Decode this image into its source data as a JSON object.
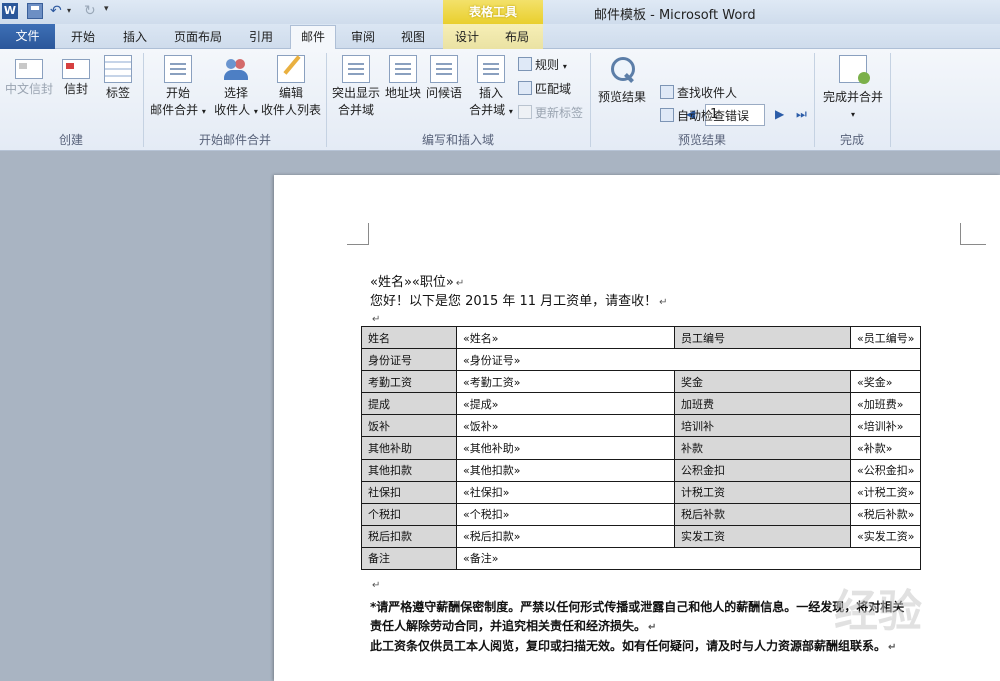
{
  "window": {
    "title": "邮件模板 - Microsoft Word",
    "context_tab_header": "表格工具",
    "app_logo_letter": "W"
  },
  "tabs": [
    {
      "label": "文件"
    },
    {
      "label": "开始"
    },
    {
      "label": "插入"
    },
    {
      "label": "页面布局"
    },
    {
      "label": "引用"
    },
    {
      "label": "邮件"
    },
    {
      "label": "审阅"
    },
    {
      "label": "视图"
    },
    {
      "label": "设计"
    },
    {
      "label": "布局"
    }
  ],
  "ribbon": {
    "create": {
      "label": "创建",
      "chinese_envelope": "中文信封",
      "envelope": "信封",
      "labels": "标签"
    },
    "start_merge": {
      "label": "开始邮件合并",
      "start_line1": "开始",
      "start_line2": "邮件合并",
      "select_line1": "选择",
      "select_line2": "收件人",
      "edit_line1": "编辑",
      "edit_line2": "收件人列表"
    },
    "write_insert": {
      "label": "编写和插入域",
      "highlight_line1": "突出显示",
      "highlight_line2": "合并域",
      "address_block": "地址块",
      "greeting_line": "问候语",
      "insert_line1": "插入",
      "insert_line2": "合并域",
      "rules": "规则",
      "match_fields": "匹配域",
      "update_labels": "更新标签"
    },
    "preview": {
      "label": "预览结果",
      "preview_results": "预览结果",
      "record_number": "1",
      "find_recipient": "查找收件人",
      "auto_check": "自动检查错误"
    },
    "finish": {
      "label": "完成",
      "finish_merge": "完成并合并"
    }
  },
  "document": {
    "line1": "«姓名»«职位»",
    "line2": "您好！以下是您 2015 年 11 月工资单，请查收！",
    "table": [
      [
        "姓名",
        "«姓名»",
        "员工编号",
        "«员工编号»"
      ],
      [
        "身份证号",
        "«身份证号»"
      ],
      [
        "考勤工资",
        "«考勤工资»",
        "奖金",
        "«奖金»"
      ],
      [
        "提成",
        "«提成»",
        "加班费",
        "«加班费»"
      ],
      [
        "饭补",
        "«饭补»",
        "培训补",
        "«培训补»"
      ],
      [
        "其他补助",
        "«其他补助»",
        "补款",
        "«补款»"
      ],
      [
        "其他扣款",
        "«其他扣款»",
        "公积金扣",
        "«公积金扣»"
      ],
      [
        "社保扣",
        "«社保扣»",
        "计税工资",
        "«计税工资»"
      ],
      [
        "个税扣",
        "«个税扣»",
        "税后补款",
        "«税后补款»"
      ],
      [
        "税后扣款",
        "«税后扣款»",
        "实发工资",
        "«实发工资»"
      ],
      [
        "备注",
        "«备注»"
      ]
    ],
    "note1": "*请严格遵守薪酬保密制度。严禁以任何形式传播或泄露自己和他人的薪酬信息。一经发现，将对相关",
    "note2": "责任人解除劳动合同，并追究相关责任和经济损失。",
    "note3": "此工资条仅供员工本人阅览，复印或扫描无效。如有任何疑问，请及时与人力资源部薪酬组联系。",
    "watermark": "经验"
  },
  "icons": {
    "paragraph_mark": "↵"
  }
}
